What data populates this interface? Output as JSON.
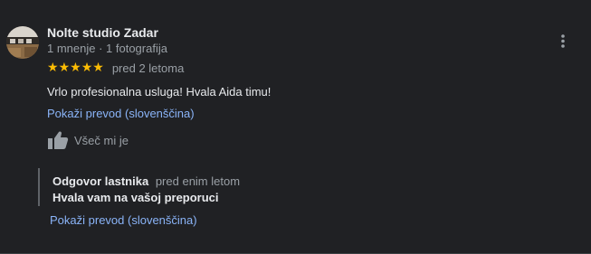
{
  "review": {
    "author": "Nolte studio Zadar",
    "meta": "1 mnenje · 1 fotografija",
    "rating": 5,
    "stars": [
      "★",
      "★",
      "★",
      "★",
      "★"
    ],
    "date": "pred 2 letoma",
    "text": "Vrlo profesionalna usluga! Hvala Aida timu!",
    "translate_link": "Pokaži prevod (slovenščina)",
    "like_label": "Všeč mi je",
    "star_color": "#fbbc04",
    "link_color": "#8ab4f8"
  },
  "owner_reply": {
    "title": "Odgovor lastnika",
    "date": "pred enim letom",
    "text": "Hvala vam na vašoj preporuci",
    "translate_link": "Pokaži prevod (slovenščina)"
  },
  "icons": {
    "avatar": "avatar-photo",
    "more": "more-vert-icon",
    "like": "thumb-up-icon"
  }
}
